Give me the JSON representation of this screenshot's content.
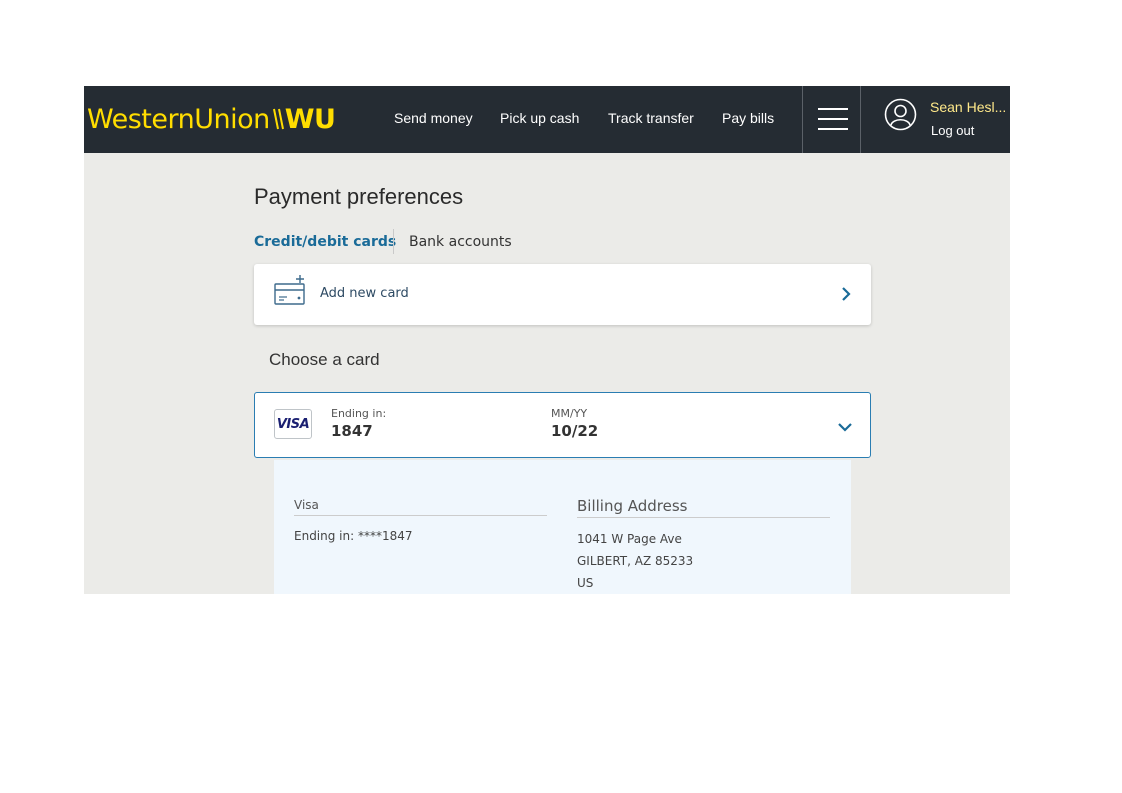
{
  "header": {
    "logo_wordmark": "WesternUnion",
    "logo_mark": "WU",
    "nav": [
      {
        "label": "Send money"
      },
      {
        "label": "Pick up cash"
      },
      {
        "label": "Track transfer"
      },
      {
        "label": "Pay bills"
      }
    ],
    "menu_icon": "hamburger-icon",
    "user_icon": "user-avatar-icon",
    "user_name": "Sean Hesl...",
    "logout_label": "Log out"
  },
  "page": {
    "title": "Payment preferences",
    "tabs": [
      {
        "label": "Credit/debit cards",
        "active": true
      },
      {
        "label": "Bank accounts",
        "active": false
      }
    ],
    "add_card": {
      "icon": "add-card-icon",
      "label": "Add new card",
      "chevron": "chevron-right-icon"
    },
    "choose_title": "Choose a card",
    "selected_card": {
      "brand": "VISA",
      "ending_label": "Ending in:",
      "ending_value": "1847",
      "expiry_label": "MM/YY",
      "expiry_value": "10/22",
      "chevron": "chevron-down-icon"
    },
    "details": {
      "card_type": "Visa",
      "ending_text": "Ending in: ****1847",
      "billing_title": "Billing Address",
      "address": [
        "1041 W Page Ave",
        "GILBERT, AZ 85233",
        "US"
      ]
    }
  },
  "colors": {
    "header_bg": "#252c33",
    "logo_yellow": "#ffdd00",
    "accent_blue": "#1a6b98",
    "page_bg": "#ebebe8",
    "details_bg": "#f0f7fd"
  }
}
